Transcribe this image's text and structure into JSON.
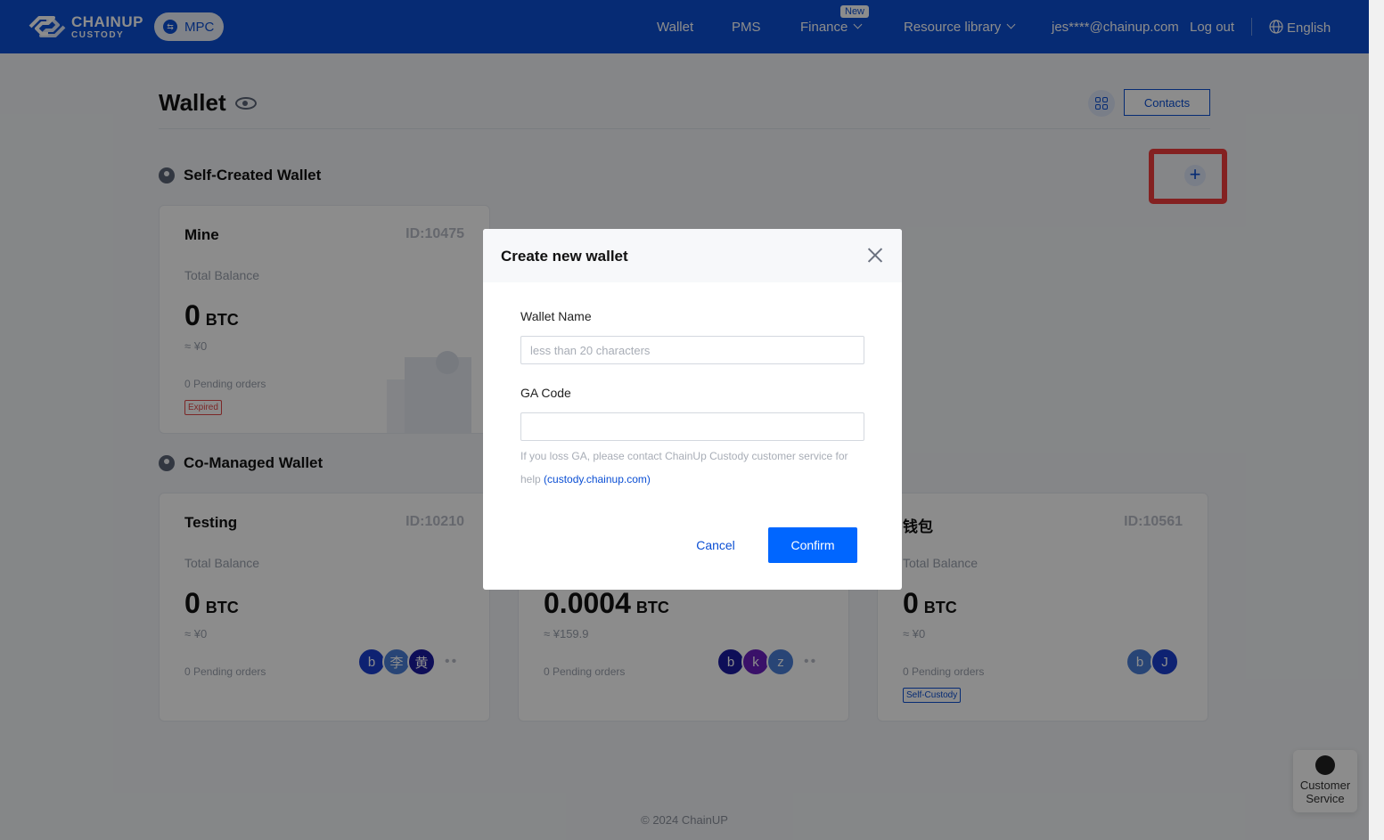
{
  "header": {
    "logo_main": "CHAINUP",
    "logo_sub": "CUSTODY",
    "mode_badge": "MPC",
    "nav": {
      "wallet": "Wallet",
      "pms": "PMS",
      "finance": "Finance",
      "finance_badge": "New",
      "resource_library": "Resource library",
      "user_email": "jes****@chainup.com",
      "logout": "Log out",
      "language": "English"
    }
  },
  "page": {
    "title": "Wallet",
    "contacts_button": "Contacts"
  },
  "self_created": {
    "section_title": "Self-Created Wallet",
    "wallets": [
      {
        "name": "Mine",
        "id": "ID:10475",
        "total_balance_label": "Total Balance",
        "balance": "0",
        "unit": "BTC",
        "fiat": "≈ ¥0",
        "pending": "0 Pending orders",
        "tag": "Expired"
      }
    ]
  },
  "co_managed": {
    "section_title": "Co-Managed Wallet",
    "wallets": [
      {
        "name": "Testing",
        "id": "ID:10210",
        "total_balance_label": "Total Balance",
        "balance": "0",
        "unit": "BTC",
        "fiat": "≈ ¥0",
        "pending": "0 Pending orders",
        "members": [
          "b",
          "李",
          "黄"
        ],
        "more": "••"
      },
      {
        "name": "",
        "id": "",
        "total_balance_label": "",
        "balance": "0.0004",
        "unit": "BTC",
        "fiat": "≈ ¥159.9",
        "pending": "0 Pending orders",
        "members": [
          "b",
          "k",
          "z"
        ],
        "more": "••"
      },
      {
        "name": "钱包",
        "id": "ID:10561",
        "total_balance_label": "Total Balance",
        "balance": "0",
        "unit": "BTC",
        "fiat": "≈ ¥0",
        "pending": "0 Pending orders",
        "members": [
          "b",
          "J"
        ],
        "tag": "Self-Custody"
      }
    ]
  },
  "modal": {
    "title": "Create new wallet",
    "wallet_name_label": "Wallet Name",
    "wallet_name_placeholder": "less than 20 characters",
    "wallet_name_value": "",
    "ga_code_label": "GA Code",
    "ga_code_value": "",
    "hint_text": "If you loss GA, please contact ChainUp Custody customer service for help",
    "hint_link": "(custody.chainup.com)",
    "cancel": "Cancel",
    "confirm": "Confirm"
  },
  "footer": {
    "copyright": "© 2024 ChainUP"
  },
  "customer_service": {
    "line1": "Customer",
    "line2": "Service"
  },
  "colors": {
    "primary": "#0b4fd4",
    "confirm": "#0066ff",
    "highlight": "#f03c3c",
    "expired": "#e04848"
  },
  "icons": {
    "view": "eye-icon",
    "layout": "grid-icon",
    "add": "plus-icon",
    "close": "close-icon",
    "language": "globe-icon",
    "support": "headset-icon"
  }
}
